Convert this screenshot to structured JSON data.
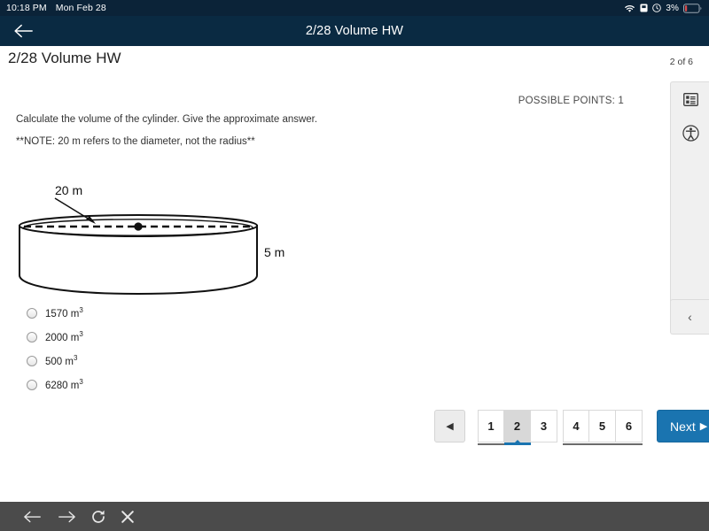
{
  "statusbar": {
    "time": "10:18 PM",
    "date": "Mon Feb 28",
    "battery_percent": "3%",
    "icons": [
      "wifi-icon",
      "sim-icon",
      "clock-icon",
      "battery-icon"
    ]
  },
  "appbar": {
    "back_label": "back-arrow",
    "title": "2/28 Volume HW",
    "background": "#0a2a42"
  },
  "page": {
    "title": "2/28 Volume HW",
    "counter": "2 of 6",
    "possible_points": "POSSIBLE POINTS: 1"
  },
  "question": {
    "prompt": "Calculate the volume of the cylinder.  Give the approximate answer.",
    "note": "**NOTE:  20 m refers to the diameter, not the radius**",
    "figure": {
      "type": "cylinder-diagram",
      "diameter_label": "20 m",
      "height_label": "5 m"
    },
    "choices": [
      {
        "value": "1570",
        "unit": "m",
        "exponent": "3",
        "selected": false
      },
      {
        "value": "2000",
        "unit": "m",
        "exponent": "3",
        "selected": false
      },
      {
        "value": "500",
        "unit": "m",
        "exponent": "3",
        "selected": false
      },
      {
        "value": "6280",
        "unit": "m",
        "exponent": "3",
        "selected": false
      }
    ]
  },
  "rail": {
    "items": [
      {
        "name": "question-list-icon"
      },
      {
        "name": "accessibility-icon"
      }
    ],
    "collapse_label": "‹"
  },
  "pager": {
    "prev_label": "◀",
    "pages": [
      "1",
      "2",
      "3",
      "4",
      "5",
      "6"
    ],
    "current": "2",
    "next_label": "Next",
    "next_arrow": "▶",
    "accent": "#1a74b0"
  },
  "browserbar": {
    "buttons": [
      "back-icon",
      "forward-icon",
      "reload-icon",
      "close-icon"
    ],
    "background": "#4b4b4b"
  }
}
